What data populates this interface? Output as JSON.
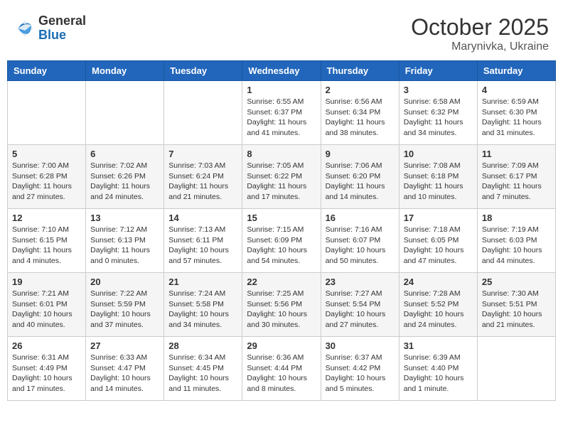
{
  "header": {
    "logo_general": "General",
    "logo_blue": "Blue",
    "month": "October 2025",
    "location": "Marynivka, Ukraine"
  },
  "days_of_week": [
    "Sunday",
    "Monday",
    "Tuesday",
    "Wednesday",
    "Thursday",
    "Friday",
    "Saturday"
  ],
  "weeks": [
    [
      {
        "day": "",
        "info": ""
      },
      {
        "day": "",
        "info": ""
      },
      {
        "day": "",
        "info": ""
      },
      {
        "day": "1",
        "info": "Sunrise: 6:55 AM\nSunset: 6:37 PM\nDaylight: 11 hours\nand 41 minutes."
      },
      {
        "day": "2",
        "info": "Sunrise: 6:56 AM\nSunset: 6:34 PM\nDaylight: 11 hours\nand 38 minutes."
      },
      {
        "day": "3",
        "info": "Sunrise: 6:58 AM\nSunset: 6:32 PM\nDaylight: 11 hours\nand 34 minutes."
      },
      {
        "day": "4",
        "info": "Sunrise: 6:59 AM\nSunset: 6:30 PM\nDaylight: 11 hours\nand 31 minutes."
      }
    ],
    [
      {
        "day": "5",
        "info": "Sunrise: 7:00 AM\nSunset: 6:28 PM\nDaylight: 11 hours\nand 27 minutes."
      },
      {
        "day": "6",
        "info": "Sunrise: 7:02 AM\nSunset: 6:26 PM\nDaylight: 11 hours\nand 24 minutes."
      },
      {
        "day": "7",
        "info": "Sunrise: 7:03 AM\nSunset: 6:24 PM\nDaylight: 11 hours\nand 21 minutes."
      },
      {
        "day": "8",
        "info": "Sunrise: 7:05 AM\nSunset: 6:22 PM\nDaylight: 11 hours\nand 17 minutes."
      },
      {
        "day": "9",
        "info": "Sunrise: 7:06 AM\nSunset: 6:20 PM\nDaylight: 11 hours\nand 14 minutes."
      },
      {
        "day": "10",
        "info": "Sunrise: 7:08 AM\nSunset: 6:18 PM\nDaylight: 11 hours\nand 10 minutes."
      },
      {
        "day": "11",
        "info": "Sunrise: 7:09 AM\nSunset: 6:17 PM\nDaylight: 11 hours\nand 7 minutes."
      }
    ],
    [
      {
        "day": "12",
        "info": "Sunrise: 7:10 AM\nSunset: 6:15 PM\nDaylight: 11 hours\nand 4 minutes."
      },
      {
        "day": "13",
        "info": "Sunrise: 7:12 AM\nSunset: 6:13 PM\nDaylight: 11 hours\nand 0 minutes."
      },
      {
        "day": "14",
        "info": "Sunrise: 7:13 AM\nSunset: 6:11 PM\nDaylight: 10 hours\nand 57 minutes."
      },
      {
        "day": "15",
        "info": "Sunrise: 7:15 AM\nSunset: 6:09 PM\nDaylight: 10 hours\nand 54 minutes."
      },
      {
        "day": "16",
        "info": "Sunrise: 7:16 AM\nSunset: 6:07 PM\nDaylight: 10 hours\nand 50 minutes."
      },
      {
        "day": "17",
        "info": "Sunrise: 7:18 AM\nSunset: 6:05 PM\nDaylight: 10 hours\nand 47 minutes."
      },
      {
        "day": "18",
        "info": "Sunrise: 7:19 AM\nSunset: 6:03 PM\nDaylight: 10 hours\nand 44 minutes."
      }
    ],
    [
      {
        "day": "19",
        "info": "Sunrise: 7:21 AM\nSunset: 6:01 PM\nDaylight: 10 hours\nand 40 minutes."
      },
      {
        "day": "20",
        "info": "Sunrise: 7:22 AM\nSunset: 5:59 PM\nDaylight: 10 hours\nand 37 minutes."
      },
      {
        "day": "21",
        "info": "Sunrise: 7:24 AM\nSunset: 5:58 PM\nDaylight: 10 hours\nand 34 minutes."
      },
      {
        "day": "22",
        "info": "Sunrise: 7:25 AM\nSunset: 5:56 PM\nDaylight: 10 hours\nand 30 minutes."
      },
      {
        "day": "23",
        "info": "Sunrise: 7:27 AM\nSunset: 5:54 PM\nDaylight: 10 hours\nand 27 minutes."
      },
      {
        "day": "24",
        "info": "Sunrise: 7:28 AM\nSunset: 5:52 PM\nDaylight: 10 hours\nand 24 minutes."
      },
      {
        "day": "25",
        "info": "Sunrise: 7:30 AM\nSunset: 5:51 PM\nDaylight: 10 hours\nand 21 minutes."
      }
    ],
    [
      {
        "day": "26",
        "info": "Sunrise: 6:31 AM\nSunset: 4:49 PM\nDaylight: 10 hours\nand 17 minutes."
      },
      {
        "day": "27",
        "info": "Sunrise: 6:33 AM\nSunset: 4:47 PM\nDaylight: 10 hours\nand 14 minutes."
      },
      {
        "day": "28",
        "info": "Sunrise: 6:34 AM\nSunset: 4:45 PM\nDaylight: 10 hours\nand 11 minutes."
      },
      {
        "day": "29",
        "info": "Sunrise: 6:36 AM\nSunset: 4:44 PM\nDaylight: 10 hours\nand 8 minutes."
      },
      {
        "day": "30",
        "info": "Sunrise: 6:37 AM\nSunset: 4:42 PM\nDaylight: 10 hours\nand 5 minutes."
      },
      {
        "day": "31",
        "info": "Sunrise: 6:39 AM\nSunset: 4:40 PM\nDaylight: 10 hours\nand 1 minute."
      },
      {
        "day": "",
        "info": ""
      }
    ]
  ]
}
